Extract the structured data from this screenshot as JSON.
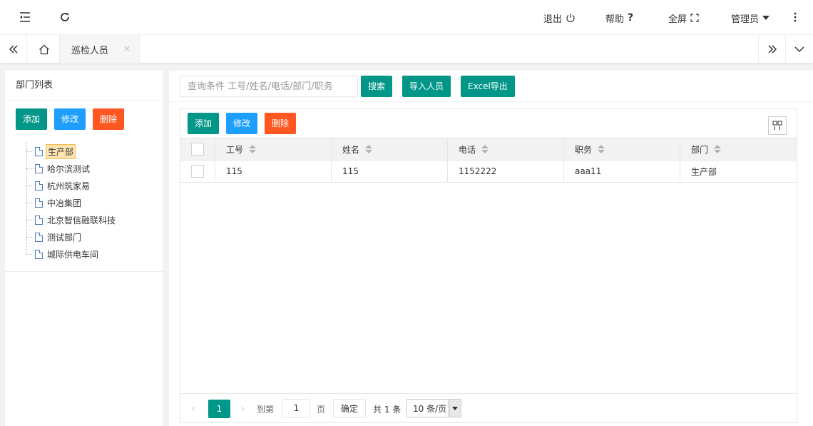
{
  "header": {
    "logout": "退出",
    "help": "帮助",
    "fullscreen": "全屏",
    "user": "管理员"
  },
  "tabs": {
    "active_label": "巡检人员",
    "close_glyph": "×"
  },
  "left_panel": {
    "title": "部门列表",
    "add": "添加",
    "edit": "修改",
    "delete": "删除",
    "tree": [
      "生产部",
      "哈尔滨测试",
      "杭州筑家易",
      "中冶集团",
      "北京智信融联科技",
      "测试部门",
      "城际供电车间"
    ]
  },
  "search": {
    "placeholder": "查询条件 工号/姓名/电话/部门/职务",
    "search_btn": "搜索",
    "import_btn": "导入人员",
    "export_btn": "Excel导出"
  },
  "table": {
    "add": "添加",
    "edit": "修改",
    "delete": "删除",
    "columns": [
      "工号",
      "姓名",
      "电话",
      "职务",
      "部门"
    ],
    "rows": [
      [
        "115",
        "115",
        "1152222",
        "aaa11",
        "生产部"
      ]
    ]
  },
  "pager": {
    "current_page": "1",
    "goto_label": "到第",
    "goto_value": "1",
    "page_unit": "页",
    "confirm": "确定",
    "total": "共 1 条",
    "page_size": "10 条/页"
  },
  "colors": {
    "primary": "#009688",
    "blue": "#1e9fff",
    "orange": "#ff5722"
  }
}
